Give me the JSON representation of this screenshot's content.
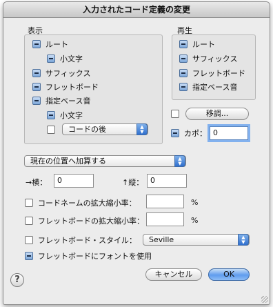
{
  "window": {
    "title": "入力されたコード定義の変更"
  },
  "display": {
    "title": "表示",
    "root": "ルート",
    "lowercase": "小文字",
    "suffix": "サフィックス",
    "fretboard": "フレットボード",
    "bass": "指定ベース音",
    "bass_lowercase": "小文字",
    "bass_position": "コードの後"
  },
  "playback": {
    "title": "再生",
    "root": "ルート",
    "suffix": "サフィックス",
    "fretboard": "フレットボード",
    "bass": "指定ベース音"
  },
  "transpose": {
    "button": "移調..."
  },
  "capo": {
    "label": "カポ：",
    "value": "0"
  },
  "position": {
    "mode": "現在の位置へ加算する",
    "x_label": "→横：",
    "x_value": "0",
    "y_label": "↑縦：",
    "y_value": "0"
  },
  "scaling": {
    "chord_name_label": "コードネームの拡大縮小率：",
    "chord_name_value": "",
    "fretboard_label": "フレットボードの拡大縮小率：",
    "fretboard_value": "",
    "unit": "%"
  },
  "style": {
    "label": "フレットボード・スタイル：",
    "value": "Seville"
  },
  "font": {
    "label": "フレットボードにフォントを使用"
  },
  "buttons": {
    "cancel": "キャンセル",
    "ok": "OK",
    "help": "?"
  },
  "colors": {
    "accent": "#5f9cee",
    "background": "#ececec"
  }
}
